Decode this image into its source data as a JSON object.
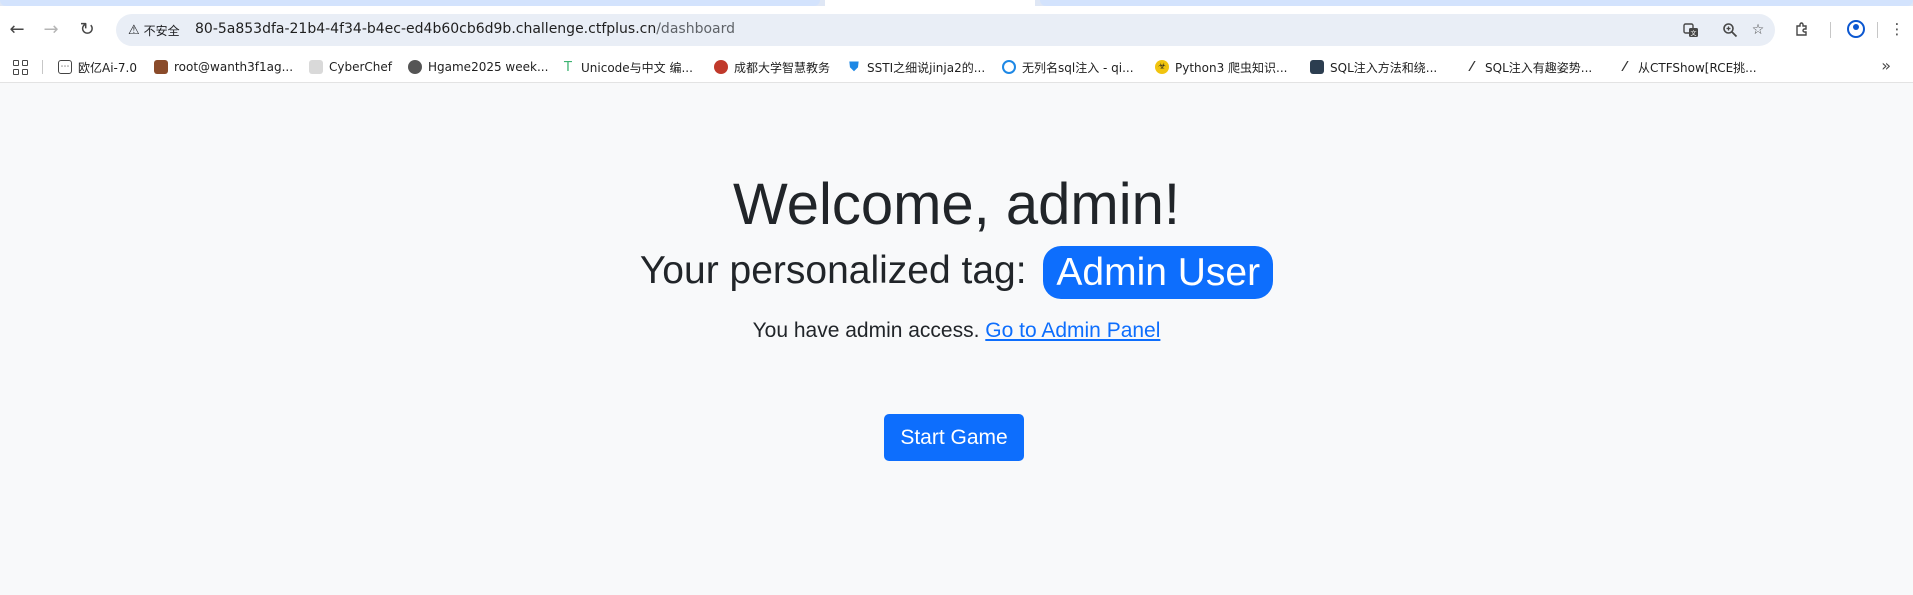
{
  "browser": {
    "security_label": "不安全",
    "url_host": "80-5a853dfa-21b4-4f34-b4ec-ed4b60cb6d9b.challenge.ctfplus.cn",
    "url_path": "/dashboard",
    "icons": {
      "back": "back-arrow-icon",
      "forward": "forward-arrow-icon",
      "reload": "reload-icon",
      "warning": "warning-icon",
      "translate": "translate-icon",
      "zoom": "zoom-icon",
      "bookmark": "star-icon",
      "extensions": "puzzle-icon",
      "profile": "profile-icon",
      "menu": "kebab-menu-icon",
      "apps": "apps-grid-icon",
      "more": "chevron-double-right-icon"
    }
  },
  "bookmarks": [
    {
      "label": "欧亿Ai-7.0",
      "icon": "chat-icon",
      "color": "#444444"
    },
    {
      "label": "root@wanth3f1ag...",
      "icon": "avatar-icon",
      "color": "#8a4b2a"
    },
    {
      "label": "CyberChef",
      "icon": "chef-hat-icon",
      "color": "#bdbdbd"
    },
    {
      "label": "Hgame2025 week...",
      "icon": "avatar-icon",
      "color": "#555555"
    },
    {
      "label": "Unicode与中文 编...",
      "icon": "tree-icon",
      "color": "#3cb371"
    },
    {
      "label": "成都大学智慧教务",
      "icon": "seal-icon",
      "color": "#c0392b"
    },
    {
      "label": "SSTI之细说jinja2的...",
      "icon": "shield-icon",
      "color": "#1e88e5"
    },
    {
      "label": "无列名sql注入 - qi...",
      "icon": "circle-logo-icon",
      "color": "#1e88e5"
    },
    {
      "label": "Python3 爬虫知识...",
      "icon": "biohazard-icon",
      "color": "#f1c40f"
    },
    {
      "label": "SQL注入方法和绕...",
      "icon": "image-icon",
      "color": "#2c3e50"
    },
    {
      "label": "SQL注入有趣姿势...",
      "icon": "slash-logo-icon",
      "color": "#333333"
    },
    {
      "label": "从CTFShow[RCE挑...",
      "icon": "slash-logo-icon",
      "color": "#333333"
    }
  ],
  "page": {
    "welcome": "Welcome, admin!",
    "tag_prefix": "Your personalized tag:",
    "tag": "Admin User",
    "admin_text": "You have admin access.",
    "admin_link": "Go to Admin Panel",
    "start_button": "Start Game"
  },
  "colors": {
    "primary": "#0d6efd",
    "background": "#f8f9fa",
    "text": "#212529"
  }
}
